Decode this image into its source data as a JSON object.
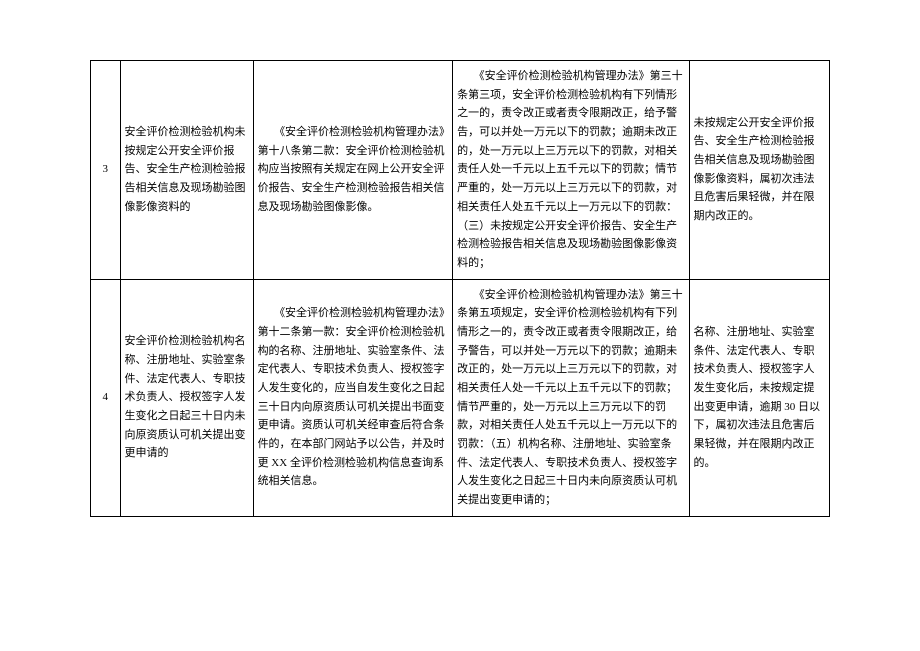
{
  "rows": [
    {
      "num": "3",
      "name": "安全评价检测检验机构未按规定公开安全评价报告、安全生产检测检验报告相关信息及现场勘验图像影像资料的",
      "basis_p1": "《安全评价检测检验机构管理办法》第十八条第二款：安全评价检测检验机构应当按照有关规定在网上公开安全评价报告、安全生产检测检验报告相关信息及现场勘验图像影像。",
      "penalty_p1": "《安全评价检测检验机构管理办法》第三十条第三项，安全评价检测检验机构有下列情形之一的，责令改正或者责令限期改正，给予警告，可以并处一万元以下的罚款；逾期未改正的，处一万元以上三万元以下的罚款，对相关责任人处一千元以上五千元以下的罚款；情节严重的，处一万元以上三万元以下的罚款，对相关责任人处五千元以上一万元以下的罚款：（三）未按规定公开安全评价报告、安全生产检测检验报告相关信息及现场勘验图像影像资料的；",
      "condition": "未按规定公开安全评价报告、安全生产检测检验报告相关信息及现场勘验图像影像资料，属初次违法且危害后果轻微，并在限期内改正的。"
    },
    {
      "num": "4",
      "name": "安全评价检测检验机构名称、注册地址、实验室条件、法定代表人、专职技术负责人、授权签字人发生变化之日起三十日内未向原资质认可机关提出变更申请的",
      "basis_p1": "《安全评价检测检验机构管理办法》第十二条第一款：安全评价检测检验机构的名称、注册地址、实验室条件、法定代表人、专职技术负责人、授权签字人发生变化的，应当自发生变化之日起三十日内向原资质认可机关提出书面变更申请。资质认可机关经审查后符合条件的，在本部门网站予以公告，并及时更 XX 全评价检测检验机构信息查询系统相关信息。",
      "penalty_p1": "《安全评价检测检验机构管理办法》第三十条第五项规定，安全评价检测检验机构有下列情形之一的，责令改正或者责令限期改正，给予警告，可以并处一万元以下的罚款；逾期未改正的，处一万元以上三万元以下的罚款，对相关责任人处一千元以上五千元以下的罚款；情节严重的，处一万元以上三万元以下的罚款，对相关责任人处五千元以上一万元以下的罚款：（五）机构名称、注册地址、实验室条件、法定代表人、专职技术负责人、授权签字人发生变化之日起三十日内未向原资质认可机关提出变更申请的；",
      "condition": "名称、注册地址、实验室条件、法定代表人、专职技术负责人、授权签字人发生变化后，未按规定提出变更申请，逾期 30 日以下，属初次违法且危害后果轻微，并在限期内改正的。"
    }
  ]
}
